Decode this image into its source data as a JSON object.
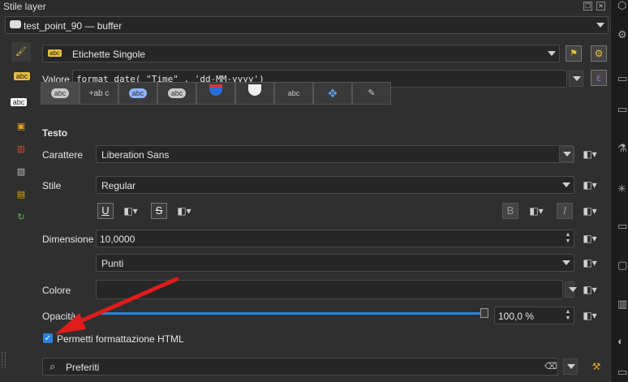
{
  "window": {
    "title": "Stile layer"
  },
  "layer_selector": {
    "value": "test_point_90 — buffer"
  },
  "renderer_combo": {
    "value": "Etichette Singole"
  },
  "value_row": {
    "label": "Valore",
    "expression": "format_date( \"Time\" , 'dd-MM-yyyy')"
  },
  "left_icons": [
    "brush-icon",
    "abc-label-icon",
    "abc-text-icon",
    "3d-cube-icon",
    "diagram-icon",
    "3d-view-icon",
    "layers-icon",
    "refresh-icon"
  ],
  "tabs": [
    {
      "name": "text",
      "label": "abc"
    },
    {
      "name": "formatting",
      "label": "+ab c"
    },
    {
      "name": "buffer",
      "label": "abc"
    },
    {
      "name": "background",
      "label": "abc"
    },
    {
      "name": "mask",
      "label": ""
    },
    {
      "name": "shadow",
      "label": ""
    },
    {
      "name": "callouts",
      "label": "abc"
    },
    {
      "name": "placement",
      "label": ""
    },
    {
      "name": "rendering",
      "label": ""
    }
  ],
  "section": {
    "title": "Testo"
  },
  "fields": {
    "font": {
      "label": "Carattere",
      "value": "Liberation Sans"
    },
    "style": {
      "label": "Stile",
      "value": "Regular"
    },
    "size": {
      "label": "Dimensione",
      "value": "10,0000"
    },
    "unit": {
      "value": "Punti"
    },
    "color": {
      "label": "Colore"
    },
    "opacity": {
      "label": "Opacità",
      "value": "100,0 %",
      "level": 1.0
    }
  },
  "format_buttons": {
    "underline": "U",
    "strike": "S",
    "bold": "B",
    "italic": "I"
  },
  "html_checkbox": {
    "label": "Permetti formattazione HTML",
    "checked": true
  },
  "search": {
    "placeholder": "Preferiti"
  },
  "colors": {
    "accent": "#2a82da",
    "annotation": "#e01b1b"
  }
}
